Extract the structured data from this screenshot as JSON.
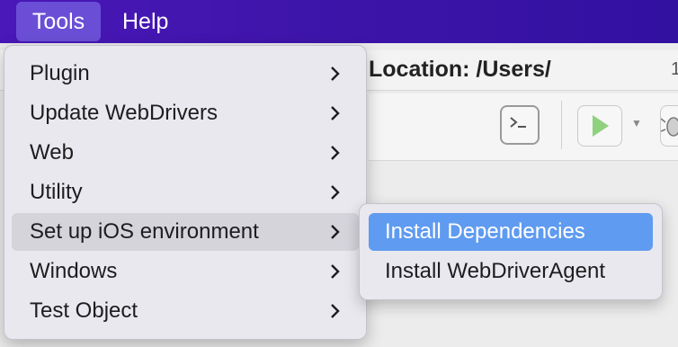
{
  "menubar": {
    "items": [
      {
        "label": "Tools"
      },
      {
        "label": "Help"
      }
    ]
  },
  "background": {
    "location_text": "Location: /Users/",
    "partial_char": "1"
  },
  "tools_menu": {
    "items": [
      {
        "label": "Plugin"
      },
      {
        "label": "Update WebDrivers"
      },
      {
        "label": "Web"
      },
      {
        "label": "Utility"
      },
      {
        "label": "Set up iOS environment"
      },
      {
        "label": "Windows"
      },
      {
        "label": "Test Object"
      }
    ],
    "highlighted_index": 4
  },
  "ios_submenu": {
    "items": [
      {
        "label": "Install Dependencies"
      },
      {
        "label": "Install WebDriverAgent"
      }
    ],
    "selected_index": 0
  },
  "colors": {
    "menubar": "#3a14a6",
    "menubar_active": "#6a4fd6",
    "selection": "#5f9bf0",
    "run_green": "#8fd17c"
  }
}
